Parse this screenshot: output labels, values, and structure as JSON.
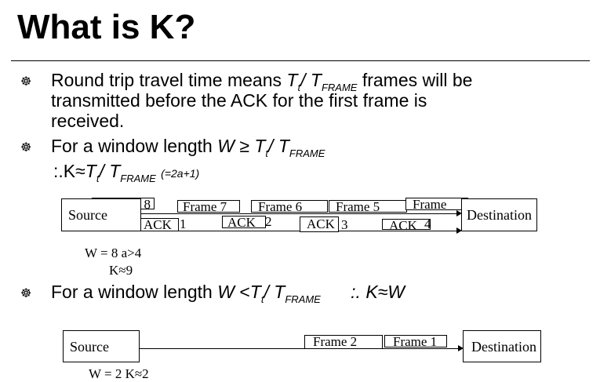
{
  "title": "What is K?",
  "bullets": [
    {
      "icon": "wheel-bullet-icon",
      "line1_pre": "Round trip travel time means ",
      "line1_post": " frames will be",
      "line2": "transmitted before the ACK for the first frame is",
      "line3": "received."
    },
    {
      "icon": "wheel-bullet-icon",
      "pre": "For a window length ",
      "W": "W",
      "op": "≥",
      "therefore": ":.K≈",
      "note": "(=2a+1)"
    },
    {
      "icon": "wheel-bullet-icon",
      "pre": "For a window length ",
      "W": "W",
      "op": "<",
      "therefore": ":. K≈W"
    }
  ],
  "formula": {
    "T": "T",
    "t": "t",
    "slash": "/",
    "frame": "FRAME"
  },
  "diagram1": {
    "source": "Source",
    "destination": "Destination",
    "frames": [
      "e 8",
      "Frame 7",
      "Frame 6",
      "Frame 5",
      "Frame"
    ],
    "acks": [
      {
        "label": "ACK",
        "n": "1"
      },
      {
        "label": "ACK",
        "n": "2"
      },
      {
        "label": "ACK",
        "n": "3"
      },
      {
        "label": "ACK",
        "n": "4"
      }
    ],
    "note1": "W = 8  a>4",
    "note2": "K≈9"
  },
  "diagram2": {
    "source": "Source",
    "destination": "Destination",
    "frames": [
      "Frame 2",
      "Frame 1"
    ],
    "note": "W = 2   K≈2"
  }
}
